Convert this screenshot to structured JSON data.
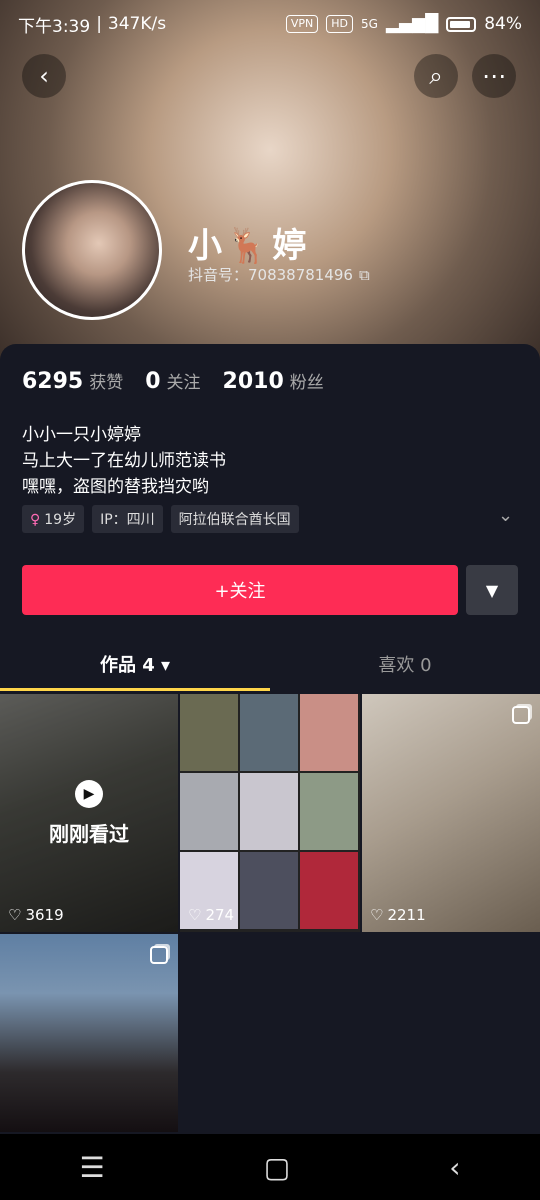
{
  "status_bar": {
    "time": "下午3:39",
    "speed": "347K/s",
    "vpn": "VPN",
    "hd": "HD",
    "network": "5G",
    "battery": "84%"
  },
  "header": {
    "back_icon": "back-arrow-icon",
    "search_icon": "search-icon",
    "more_icon": "more-icon"
  },
  "profile": {
    "name": "小🦌婷",
    "douyin_id": "抖音号：70838781496",
    "copy_icon": "copy-icon"
  },
  "stats": [
    {
      "value": "6295",
      "label": "获赞"
    },
    {
      "value": "0",
      "label": "关注"
    },
    {
      "value": "2010",
      "label": "粉丝"
    }
  ],
  "bio": [
    "小小一只小婷婷",
    "马上大一了在幼儿师范读书",
    "嘿嘿，盗图的替我挡灾哟"
  ],
  "tags": {
    "age": "19岁",
    "ip": "IP：四川",
    "location": "阿拉伯联合酋长国"
  },
  "actions": {
    "follow": "+关注",
    "dropdown": "▼"
  },
  "tabs": {
    "works": "作品 4 ▾",
    "likes": "喜欢 0"
  },
  "grid": {
    "watched_label": "刚刚看过",
    "items": [
      {
        "likes": "3619"
      },
      {
        "likes": "274"
      },
      {
        "likes": "2211"
      },
      {
        "likes": ""
      }
    ]
  },
  "navbar": {
    "menu": "☰",
    "home": "▢",
    "back": "‹"
  }
}
